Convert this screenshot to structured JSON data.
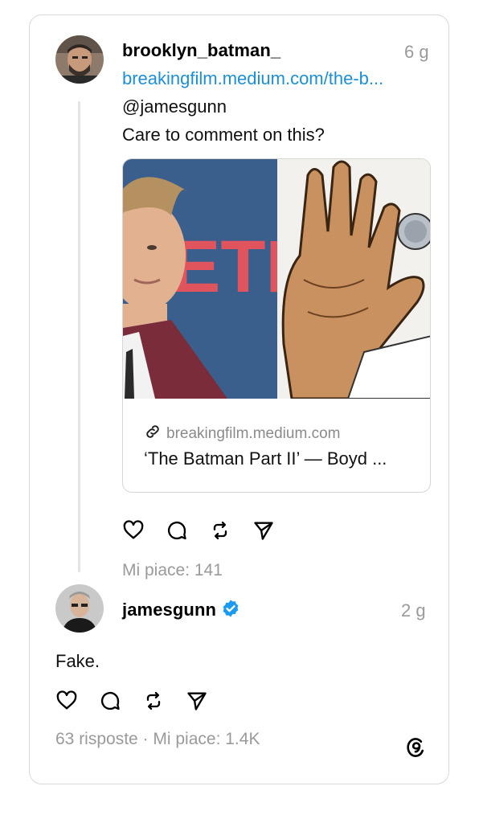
{
  "post": {
    "username": "brooklyn_batman_",
    "time": "6 g",
    "link": "breakingfilm.medium.com/the-b...",
    "mention": "@jamesgunn",
    "text": "Care to comment on this?",
    "preview": {
      "banner_letters": "ETFL",
      "domain": "breakingfilm.medium.com",
      "title": "‘The Batman Part II’ — Boyd ..."
    },
    "likes": "Mi piace: 141"
  },
  "reply": {
    "username": "jamesgunn",
    "time": "2 g",
    "text": "Fake.",
    "meta": "63 risposte · Mi piace: 1.4K"
  },
  "colors": {
    "link": "#1c8fd6",
    "verified": "#1d9bf0",
    "muted": "#9a9a9a"
  },
  "icons": [
    "heart-icon",
    "comment-icon",
    "repost-icon",
    "share-icon",
    "link-icon",
    "verified-badge-icon",
    "threads-logo-icon"
  ]
}
